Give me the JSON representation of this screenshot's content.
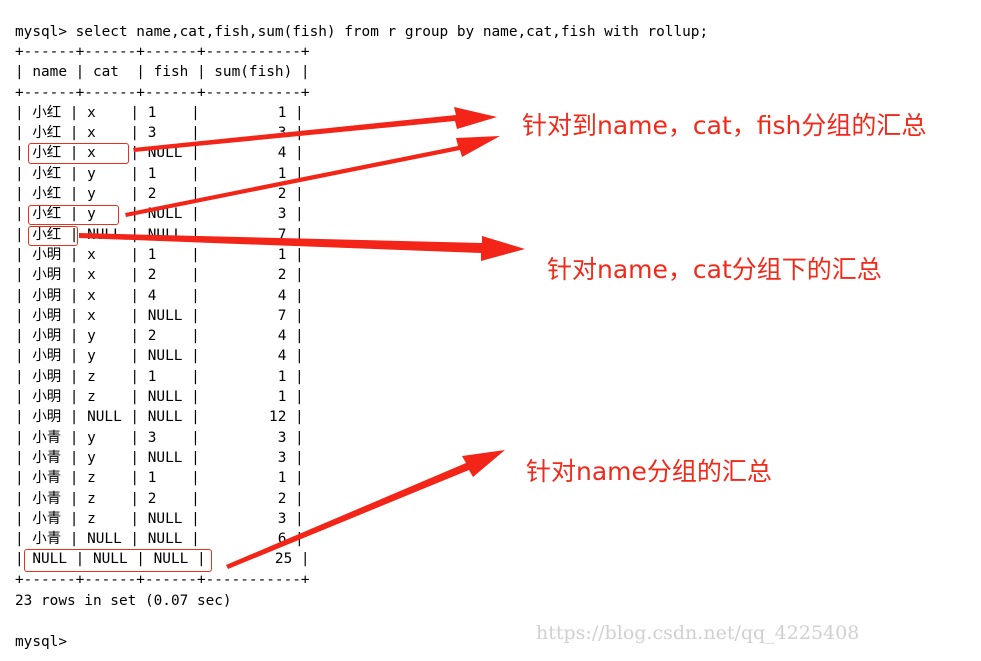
{
  "terminal": {
    "command": "mysql> select name,cat,fish,sum(fish) from r group by name,cat,fish with rollup;",
    "border": "+------+------+------+-----------+",
    "headers": [
      "name",
      "cat",
      "fish",
      "sum(fish)"
    ],
    "rows": [
      [
        "小红",
        "x",
        "1",
        "1"
      ],
      [
        "小红",
        "x",
        "3",
        "3"
      ],
      [
        "小红",
        "x",
        "NULL",
        "4"
      ],
      [
        "小红",
        "y",
        "1",
        "1"
      ],
      [
        "小红",
        "y",
        "2",
        "2"
      ],
      [
        "小红",
        "y",
        "NULL",
        "3"
      ],
      [
        "小红",
        "NULL",
        "NULL",
        "7"
      ],
      [
        "小明",
        "x",
        "1",
        "1"
      ],
      [
        "小明",
        "x",
        "2",
        "2"
      ],
      [
        "小明",
        "x",
        "4",
        "4"
      ],
      [
        "小明",
        "x",
        "NULL",
        "7"
      ],
      [
        "小明",
        "y",
        "2",
        "4"
      ],
      [
        "小明",
        "y",
        "NULL",
        "4"
      ],
      [
        "小明",
        "z",
        "1",
        "1"
      ],
      [
        "小明",
        "z",
        "NULL",
        "1"
      ],
      [
        "小明",
        "NULL",
        "NULL",
        "12"
      ],
      [
        "小青",
        "y",
        "3",
        "3"
      ],
      [
        "小青",
        "y",
        "NULL",
        "3"
      ],
      [
        "小青",
        "z",
        "1",
        "1"
      ],
      [
        "小青",
        "z",
        "2",
        "2"
      ],
      [
        "小青",
        "z",
        "NULL",
        "3"
      ],
      [
        "小青",
        "NULL",
        "NULL",
        "6"
      ],
      [
        "NULL",
        "NULL",
        "NULL",
        "25"
      ]
    ],
    "footer": "23 rows in set (0.07 sec)",
    "prompt": "mysql>"
  },
  "annotations": {
    "note1": "针对到name，cat，fish分组的汇总",
    "note2": "针对name，cat分组下的汇总",
    "note3": "针对name分组的汇总",
    "color": "#f02a1b"
  },
  "watermark": "https://blog.csdn.net/qq_4225408"
}
